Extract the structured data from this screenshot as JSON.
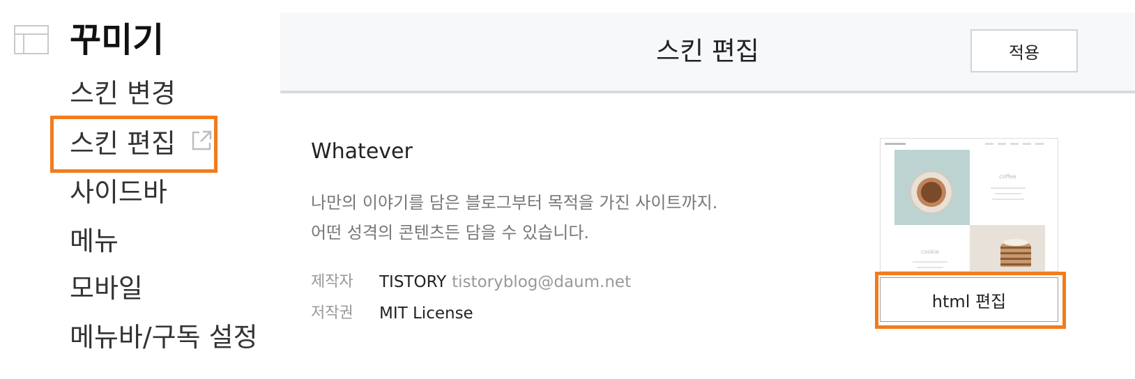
{
  "sidebar": {
    "icon": "layout-icon",
    "title": "꾸미기",
    "items": [
      {
        "label": "스킨 변경"
      },
      {
        "label": "스킨 편집",
        "icon": "external-link-icon"
      },
      {
        "label": "사이드바"
      },
      {
        "label": "메뉴"
      },
      {
        "label": "모바일"
      },
      {
        "label": "메뉴바/구독 설정"
      }
    ]
  },
  "header": {
    "title": "스킨 편집",
    "apply_label": "적용"
  },
  "skin": {
    "name": "Whatever",
    "description": [
      "나만의 이야기를 담은 블로그부터 목적을 가진 사이트까지.",
      "어떤 성격의 콘텐츠든 담을 수 있습니다."
    ],
    "author_label": "제작자",
    "author": "TISTORY",
    "author_email": "tistoryblog@daum.net",
    "license_label": "저작권",
    "license": "MIT License",
    "thumbnail": {
      "tile_coffee": "coffee",
      "tile_cookie": "cookie"
    },
    "html_edit_label": "html 편집"
  },
  "colors": {
    "highlight": "#f07c1d",
    "header_bg": "#f7f8fa",
    "muted_text": "#777777"
  }
}
